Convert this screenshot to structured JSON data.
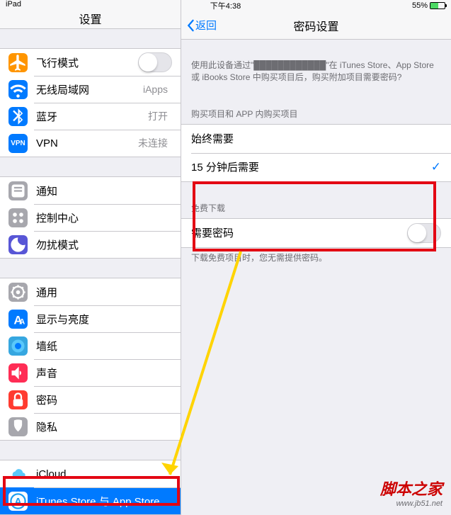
{
  "status": {
    "device": "iPad",
    "time": "下午4:38",
    "battery": "55%"
  },
  "left": {
    "title": "设置",
    "g1": [
      {
        "icon": "airplane-icon",
        "color": "#ff9500",
        "label": "飞行模式",
        "acc": "toggle"
      },
      {
        "icon": "wifi-icon",
        "color": "#007aff",
        "label": "无线局域网",
        "detail": "iApps"
      },
      {
        "icon": "bluetooth-icon",
        "color": "#007aff",
        "label": "蓝牙",
        "detail": "打开"
      },
      {
        "icon": "vpn-icon",
        "color": "#007aff",
        "label": "VPN",
        "detail": "未连接",
        "text": "VPN"
      }
    ],
    "g2": [
      {
        "icon": "notifications-icon",
        "color": "#a7a7ad",
        "label": "通知"
      },
      {
        "icon": "control-center-icon",
        "color": "#a7a7ad",
        "label": "控制中心"
      },
      {
        "icon": "dnd-icon",
        "color": "#5856d6",
        "label": "勿扰模式"
      }
    ],
    "g3": [
      {
        "icon": "general-icon",
        "color": "#a7a7ad",
        "label": "通用"
      },
      {
        "icon": "display-icon",
        "color": "#007aff",
        "label": "显示与亮度"
      },
      {
        "icon": "wallpaper-icon",
        "color": "#36a7e0",
        "label": "墙纸"
      },
      {
        "icon": "sounds-icon",
        "color": "#ff2d55",
        "label": "声音"
      },
      {
        "icon": "passcode-icon",
        "color": "#ff3b30",
        "label": "密码"
      },
      {
        "icon": "privacy-icon",
        "color": "#a7a7ad",
        "label": "隐私"
      }
    ],
    "g4": [
      {
        "icon": "icloud-icon",
        "color": "#fff",
        "label": "iCloud"
      },
      {
        "icon": "appstore-icon",
        "color": "#1e9ff0",
        "label": "iTunes Store 与 App Store",
        "selected": true
      }
    ]
  },
  "right": {
    "title": "密码设置",
    "back": "返回",
    "intro": "使用此设备通过\"████████████\"在 iTunes Store、App Store 或 iBooks Store 中购买项目后，购买附加项目需要密码?",
    "sec1": "购买项目和 APP 内购买项目",
    "opt1": "始终需要",
    "opt2": "15 分钟后需要",
    "sec2": "免费下载",
    "req": "需要密码",
    "foot": "下载免费项目时，您无需提供密码。"
  },
  "watermark": {
    "t1": "脚本之家",
    "t2": "www.jb51.net"
  }
}
